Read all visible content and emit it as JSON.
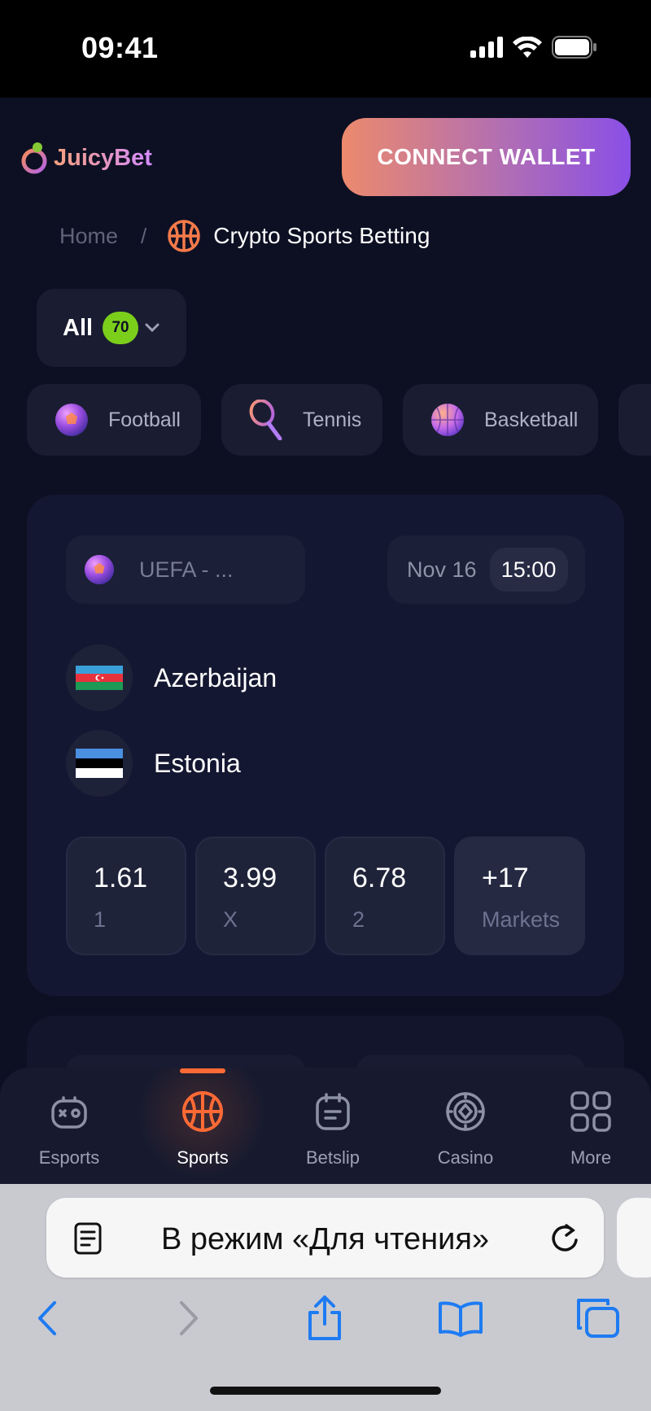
{
  "status_bar": {
    "time": "09:41",
    "icons": [
      "cellular-signal-icon",
      "wifi-icon",
      "battery-icon"
    ]
  },
  "header": {
    "logo_text": "JuicyBet",
    "connect_wallet_label": "CONNECT WALLET"
  },
  "breadcrumb": {
    "home": "Home",
    "separator": "/",
    "current": "Crypto Sports Betting",
    "current_icon": "basketball-icon"
  },
  "filter": {
    "label": "All",
    "count": "70"
  },
  "sports": [
    {
      "label": "Football",
      "icon": "football-icon"
    },
    {
      "label": "Tennis",
      "icon": "tennis-icon"
    },
    {
      "label": "Basketball",
      "icon": "basketball-icon"
    }
  ],
  "match": {
    "league": "UEFA - ...",
    "date": "Nov 16",
    "time": "15:00",
    "home_team": "Azerbaijan",
    "away_team": "Estonia",
    "odds": [
      {
        "value": "1.61",
        "label": "1"
      },
      {
        "value": "3.99",
        "label": "X"
      },
      {
        "value": "6.78",
        "label": "2"
      }
    ],
    "more_markets": {
      "value": "+17",
      "label": "Markets"
    }
  },
  "bottom_nav": [
    {
      "label": "Esports",
      "icon": "gamepad-icon"
    },
    {
      "label": "Sports",
      "icon": "basketball-icon",
      "active": true
    },
    {
      "label": "Betslip",
      "icon": "betslip-icon"
    },
    {
      "label": "Casino",
      "icon": "casino-chip-icon"
    },
    {
      "label": "More",
      "icon": "grid-icon"
    }
  ],
  "browser": {
    "address_text": "В режим «Для чтения»"
  },
  "colors": {
    "background": "#0d1023",
    "accent": "#ff6a35",
    "badge": "#7bcf1b",
    "safari_blue": "#1e7bf2"
  }
}
